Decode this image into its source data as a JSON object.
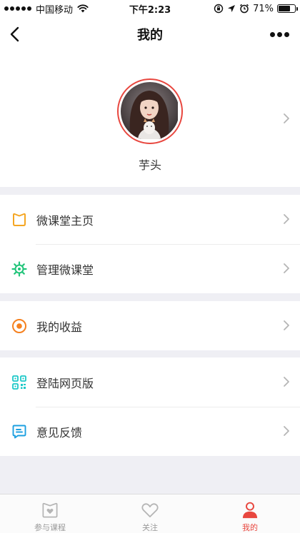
{
  "status_bar": {
    "carrier": "中国移动",
    "time": "下午2:23",
    "battery": "71%",
    "battery_level": 0.71
  },
  "nav": {
    "title": "我的",
    "back_icon": "chevron-left-icon",
    "more_icon": "more-dots-icon"
  },
  "profile": {
    "username": "芋头",
    "avatar_border_color": "#e8473f"
  },
  "menu_groups": [
    {
      "items": [
        {
          "label": "微课堂主页",
          "icon": "home-page-icon",
          "color": "#f5a623"
        },
        {
          "label": "管理微课堂",
          "icon": "gear-icon",
          "color": "#22c47a"
        }
      ]
    },
    {
      "items": [
        {
          "label": "我的收益",
          "icon": "earnings-icon",
          "color": "#f5811f"
        }
      ]
    },
    {
      "items": [
        {
          "label": "登陆网页版",
          "icon": "qr-code-icon",
          "color": "#1dc8c8"
        },
        {
          "label": "意见反馈",
          "icon": "feedback-icon",
          "color": "#1da0e0"
        }
      ]
    }
  ],
  "tabs": [
    {
      "label": "参与课程",
      "icon": "course-book-icon",
      "active": false
    },
    {
      "label": "关注",
      "icon": "heart-icon",
      "active": false
    },
    {
      "label": "我的",
      "icon": "person-icon",
      "active": true
    }
  ],
  "accent_color": "#e8473f"
}
